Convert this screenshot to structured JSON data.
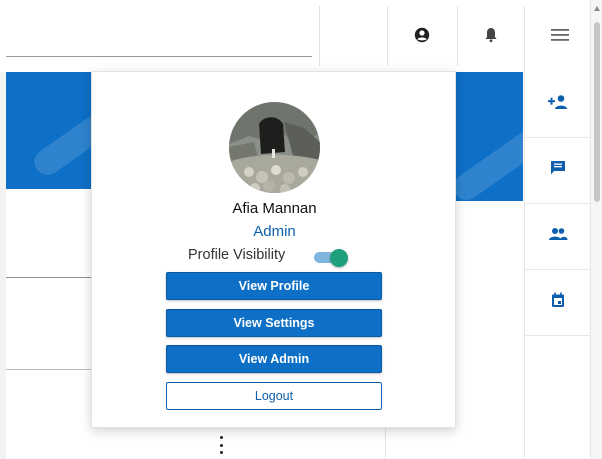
{
  "header": {
    "icons": [
      "user-circle-icon",
      "bell-icon",
      "hamburger-menu-icon"
    ]
  },
  "rail": {
    "items": [
      {
        "icon": "add-person-icon"
      },
      {
        "icon": "chat-icon"
      },
      {
        "icon": "group-icon"
      },
      {
        "icon": "calendar-icon"
      }
    ]
  },
  "profile_menu": {
    "name": "Afia Mannan",
    "role": "Admin",
    "visibility_label": "Profile Visibility",
    "visibility_on": true,
    "buttons": {
      "view_profile": "View Profile",
      "view_settings": "View Settings",
      "view_admin": "View Admin",
      "logout": "Logout"
    }
  },
  "colors": {
    "primary": "#0d6fc6",
    "role_text": "#0d5fad",
    "toggle_knob": "#1ea07c",
    "toggle_track": "#7fb6de"
  }
}
